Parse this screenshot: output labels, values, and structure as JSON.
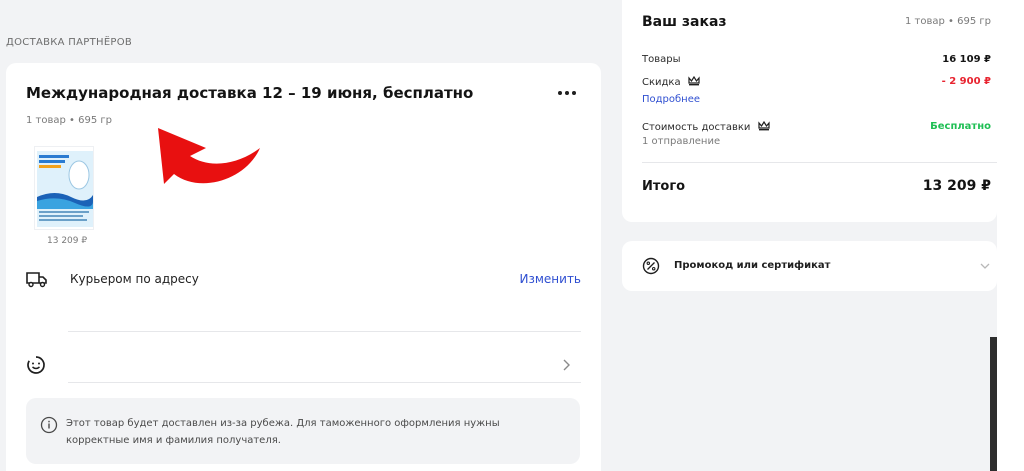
{
  "section_label": "ДОСТАВКА ПАРТНЁРОВ",
  "delivery": {
    "title": "Международная доставка 12 – 19 июня, бесплатно",
    "meta": "1 товар • 695 гр",
    "product": {
      "price": "13 209 ₽",
      "image_icon": "product-package-image"
    },
    "courier_label": "Курьером по адресу",
    "change_label": "Изменить",
    "time_icon": "face-timer-icon",
    "info_text": "Этот товар будет доставлен из-за рубежа. Для таможенного оформления нужны корректные имя и фамилия получателя."
  },
  "summary": {
    "title": "Ваш заказ",
    "meta": "1 товар • 695 гр",
    "goods_label": "Товары",
    "goods_value": "16 109 ₽",
    "discount_label": "Скидка",
    "discount_value": "- 2 900 ₽",
    "more_label": "Подробнее",
    "shipping_label": "Стоимость доставки",
    "shipping_value": "Бесплатно",
    "shipments": "1 отправление",
    "total_label": "Итого",
    "total_value": "13 209 ₽"
  },
  "promo": {
    "label": "Промокод или сертификат"
  },
  "colors": {
    "accent": "#2f4fd1",
    "discount": "#e8232f",
    "free": "#1fbf54",
    "annotation": "#e81010"
  }
}
